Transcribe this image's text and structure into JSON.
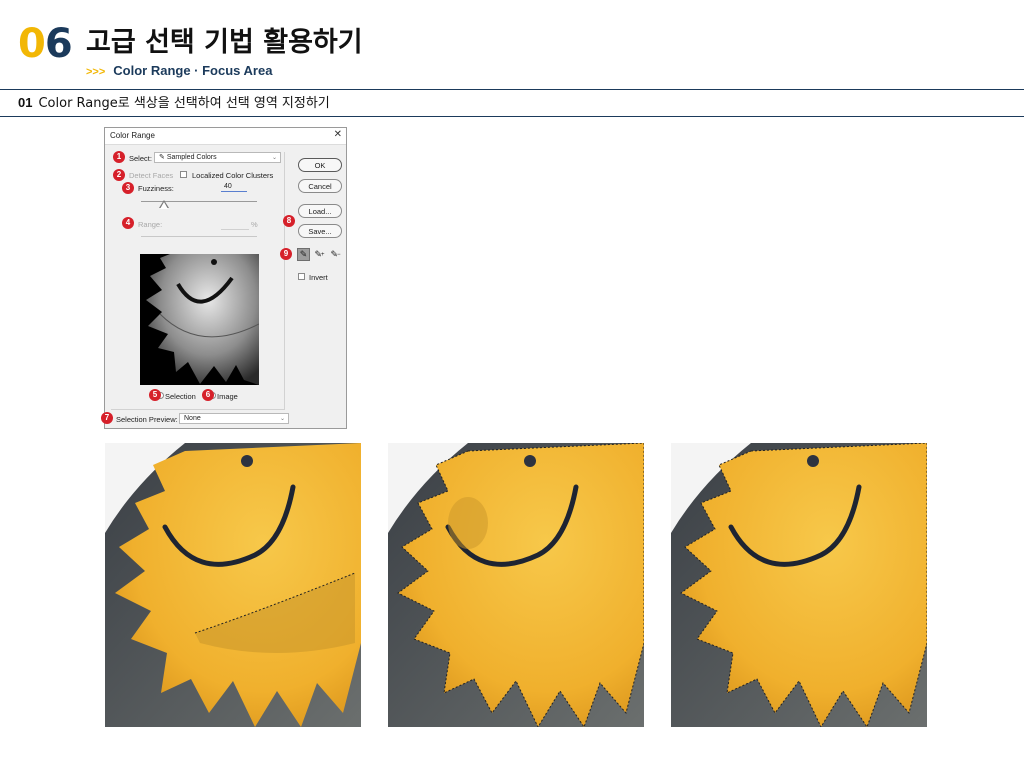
{
  "header": {
    "chapter_number_a": "0",
    "chapter_number_b": "6",
    "title": "고급 선택 기법 활용하기",
    "subtitle_arrow": ">>>",
    "subtitle": "Color Range · Focus Area"
  },
  "section": {
    "number": "01",
    "text": "Color Range로 색상을 선택하여 선택 영역 지정하기"
  },
  "dialog": {
    "title": "Color Range",
    "close_glyph": "✕",
    "select_label": "Select:",
    "select_value": "Sampled Colors",
    "detect_faces_label": "Detect Faces",
    "localized_label": "Localized Color Clusters",
    "fuzziness_label": "Fuzziness:",
    "fuzziness_value": "40",
    "range_label": "Range:",
    "range_unit": "%",
    "selection_label": "Selection",
    "image_label": "Image",
    "selection_preview_label": "Selection Preview:",
    "selection_preview_value": "None",
    "ok_label": "OK",
    "cancel_label": "Cancel",
    "load_label": "Load...",
    "save_label": "Save...",
    "invert_label": "Invert"
  },
  "badges": [
    "1",
    "2",
    "3",
    "4",
    "5",
    "6",
    "7",
    "8",
    "9"
  ],
  "colors": {
    "accent_yellow": "#f2b705",
    "navy": "#1b3a5b",
    "badge_red": "#d6202a",
    "sun_yellow": "#f2b531"
  },
  "icons": [
    "eyedropper-icon",
    "eyedropper-plus-icon",
    "eyedropper-minus-icon",
    "close-icon",
    "chevron-down-icon"
  ]
}
